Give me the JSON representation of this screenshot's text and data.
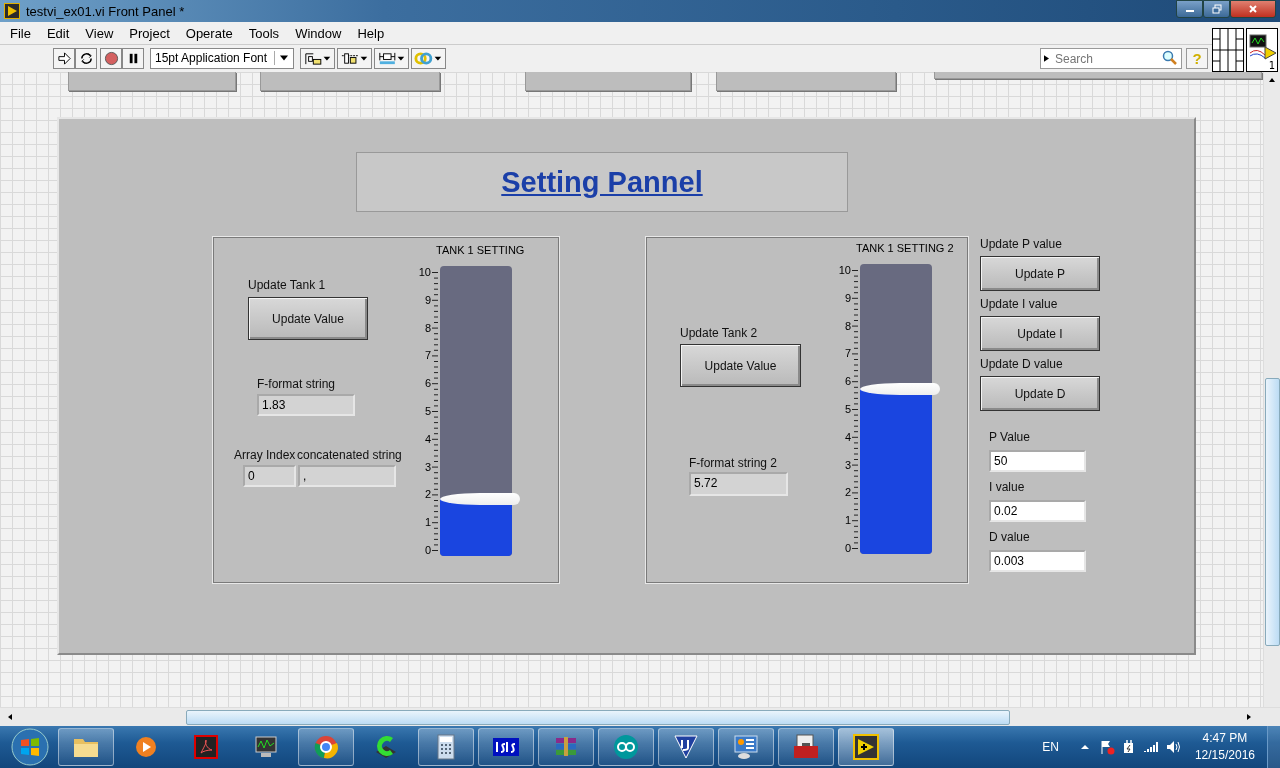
{
  "window": {
    "title": "testvi_ex01.vi Front Panel *"
  },
  "menu": [
    "File",
    "Edit",
    "View",
    "Project",
    "Operate",
    "Tools",
    "Window",
    "Help"
  ],
  "toolbar": {
    "font": "15pt Application Font",
    "search": {
      "placeholder": "Search"
    },
    "help": "?",
    "connector_number": "1"
  },
  "panel": {
    "title": "Setting Pannel",
    "groups": [
      {
        "update_label": "Update Tank 1",
        "button": "Update Value",
        "string_label": "F-format string",
        "string_value": "1.83",
        "index_label": "Array Index",
        "index_value": "0",
        "concat_label": "concatenated string",
        "concat_value": ",",
        "tank": {
          "title": "TANK 1 SETTING",
          "level": 0.183,
          "scale": [
            "10",
            "9",
            "8",
            "7",
            "6",
            "5",
            "4",
            "3",
            "2",
            "1",
            "0"
          ]
        }
      },
      {
        "update_label": "Update Tank 2",
        "button": "Update Value",
        "string_label": "F-format string 2",
        "string_value": "5.72",
        "tank": {
          "title": "TANK 1 SETTING 2",
          "level": 0.572,
          "scale": [
            "10",
            "9",
            "8",
            "7",
            "6",
            "5",
            "4",
            "3",
            "2",
            "1",
            "0"
          ]
        }
      }
    ],
    "pid_buttons": [
      {
        "label": "Update P value",
        "button": "Update P"
      },
      {
        "label": "Update I value",
        "button": "Update I"
      },
      {
        "label": "Update D value",
        "button": "Update D"
      }
    ],
    "pid_values": [
      {
        "label": "P Value",
        "value": "50"
      },
      {
        "label": "I value",
        "value": "0.02"
      },
      {
        "label": "D value",
        "value": "0.003"
      }
    ]
  },
  "tray": {
    "language": "EN",
    "time": "4:47 PM",
    "date": "12/15/2016"
  }
}
